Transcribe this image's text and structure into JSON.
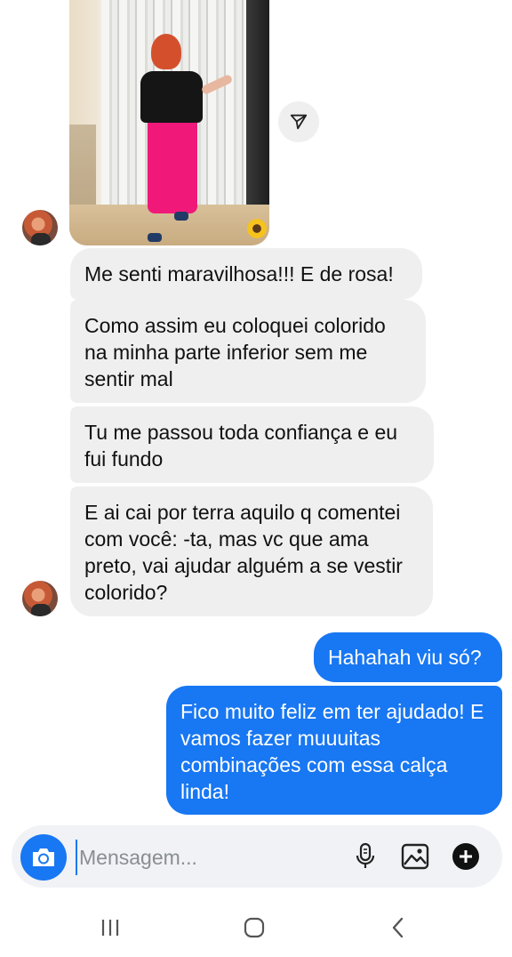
{
  "conversation": {
    "messages": [
      {
        "side": "in",
        "text": "Me senti maravilhosa!!! E de rosa!"
      },
      {
        "side": "in",
        "text": "Como assim eu coloquei colorido na minha parte inferior sem me sentir mal"
      },
      {
        "side": "in",
        "text": "Tu me passou toda confiança e eu fui fundo"
      },
      {
        "side": "in",
        "text": "E ai cai por terra aquilo q comentei com você: -ta, mas vc que ama preto, vai ajudar alguém a se vestir colorido?"
      },
      {
        "side": "out",
        "text": "Hahahah viu só?"
      },
      {
        "side": "out",
        "text": "Fico muito feliz em ter ajudado! E vamos fazer muuuitas combinações com essa calça linda!"
      }
    ]
  },
  "composer": {
    "placeholder": "Mensagem...",
    "value": ""
  },
  "icons": {
    "share": "paper-plane-icon",
    "camera": "camera-icon",
    "mic": "microphone-icon",
    "gallery": "image-icon",
    "more": "plus-circle-icon",
    "nav_recent": "recent-apps-icon",
    "nav_home": "home-icon",
    "nav_back": "back-icon"
  },
  "colors": {
    "accent": "#1877f2",
    "incoming_bubble": "#efefef",
    "outgoing_text": "#ffffff"
  }
}
